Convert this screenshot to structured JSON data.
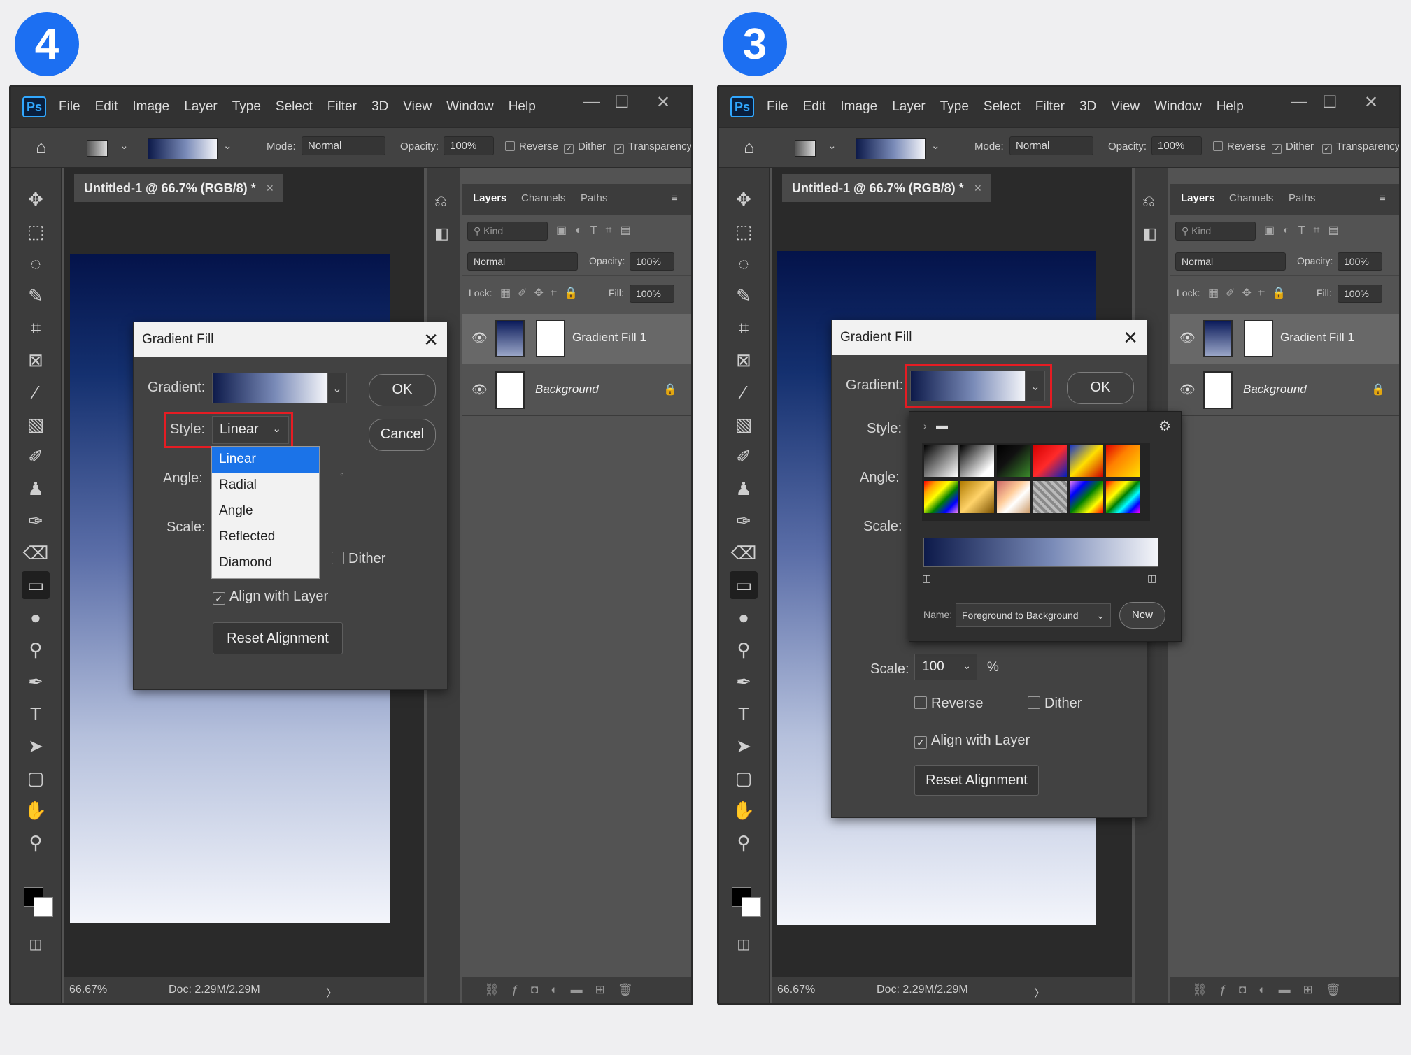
{
  "badges": {
    "left": "4",
    "right": "3"
  },
  "app": {
    "logo": "Ps",
    "menu": [
      "File",
      "Edit",
      "Image",
      "Layer",
      "Type",
      "Select",
      "Filter",
      "3D",
      "View",
      "Window",
      "Help"
    ],
    "window_controls": {
      "minimize": "—",
      "maximize": "☐",
      "close": "✕"
    }
  },
  "options_bar": {
    "mode_label": "Mode:",
    "mode_value": "Normal",
    "opacity_label": "Opacity:",
    "opacity_value": "100%",
    "reverse": "Reverse",
    "dither": "Dither",
    "transparency": "Transparency"
  },
  "document": {
    "tab_title": "Untitled-1 @ 66.7% (RGB/8) *",
    "tab_close": "×"
  },
  "status": {
    "zoom": "66.67%",
    "doc": "Doc: 2.29M/2.29M",
    "arrow": "〉"
  },
  "layers_panel": {
    "tabs": [
      "Layers",
      "Channels",
      "Paths"
    ],
    "kind_placeholder": "Kind",
    "blend_mode": "Normal",
    "opacity_label": "Opacity:",
    "opacity_value": "100%",
    "lock_label": "Lock:",
    "fill_label": "Fill:",
    "fill_value": "100%",
    "layers": [
      {
        "name": "Gradient Fill 1"
      },
      {
        "name": "Background"
      }
    ],
    "footer_icons": [
      "link-icon",
      "fx-icon",
      "mask-icon",
      "adjustment-icon",
      "folder-icon",
      "new-layer-icon",
      "trash-icon"
    ]
  },
  "dialog_left": {
    "title": "Gradient Fill",
    "gradient_label": "Gradient:",
    "style_label": "Style:",
    "style_value": "Linear",
    "angle_label": "Angle:",
    "scale_label": "Scale:",
    "ok": "OK",
    "cancel": "Cancel",
    "dither": "Dither",
    "align_with_layer": "Align with Layer",
    "reset_alignment": "Reset Alignment",
    "degree_symbol": "°",
    "style_options": [
      "Linear",
      "Radial",
      "Angle",
      "Reflected",
      "Diamond"
    ],
    "selected_style": "Linear"
  },
  "dialog_right": {
    "title": "Gradient Fill",
    "gradient_label": "Gradient:",
    "style_label": "Style:",
    "angle_label": "Angle:",
    "scale_label": "Scale:",
    "ok": "OK",
    "scale_value": "100",
    "scale_unit": "%",
    "reverse": "Reverse",
    "dither": "Dither",
    "align_with_layer": "Align with Layer",
    "reset_alignment": "Reset Alignment",
    "picker": {
      "name_label": "Name:",
      "name_value": "Foreground to Background",
      "new_button": "New"
    }
  },
  "colors": {
    "accent": "#1b73e8",
    "highlight": "#e51c23",
    "badge": "#1c6ff2"
  }
}
